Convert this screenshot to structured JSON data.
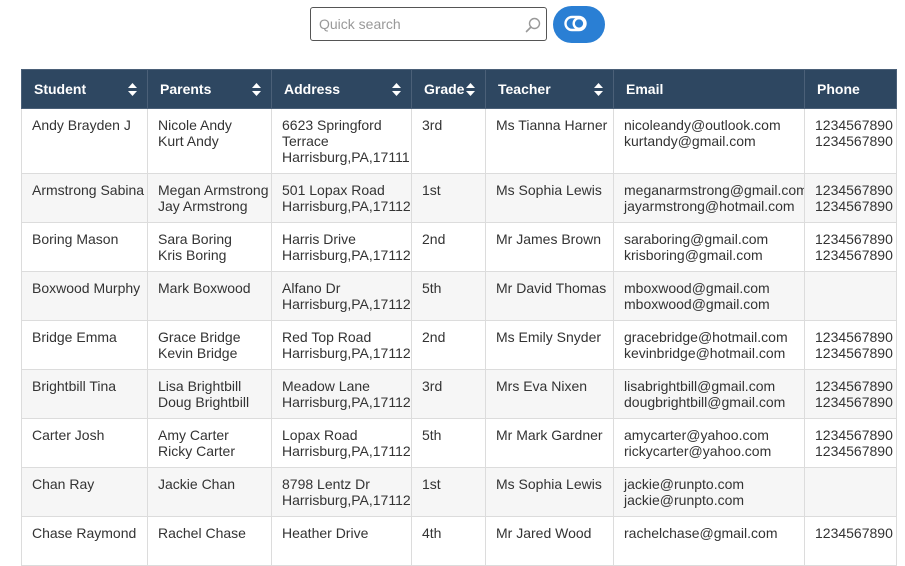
{
  "search": {
    "placeholder": "Quick search"
  },
  "table": {
    "headers": [
      "Student",
      "Parents",
      "Address",
      "Grade",
      "Teacher",
      "Email",
      "Phone"
    ],
    "rows": [
      {
        "student": "Andy Brayden J",
        "parents": [
          "Nicole Andy",
          "Kurt Andy"
        ],
        "address": [
          "6623 Springford",
          "Terrace",
          "Harrisburg,PA,17111"
        ],
        "grade": "3rd",
        "teacher": "Ms Tianna Harner",
        "email": [
          "nicoleandy@outlook.com",
          "kurtandy@gmail.com"
        ],
        "phone": [
          "1234567890",
          "1234567890"
        ]
      },
      {
        "student": "Armstrong Sabina",
        "parents": [
          "Megan Armstrong",
          "Jay Armstrong"
        ],
        "address": [
          "501 Lopax Road",
          "Harrisburg,PA,17112"
        ],
        "grade": "1st",
        "teacher": "Ms Sophia Lewis",
        "email": [
          "meganarmstrong@gmail.com",
          "jayarmstrong@hotmail.com"
        ],
        "phone": [
          "1234567890",
          "1234567890"
        ]
      },
      {
        "student": "Boring Mason",
        "parents": [
          "Sara Boring",
          "Kris Boring"
        ],
        "address": [
          "Harris Drive",
          "Harrisburg,PA,17112"
        ],
        "grade": "2nd",
        "teacher": "Mr James Brown",
        "email": [
          "saraboring@gmail.com",
          "krisboring@gmail.com"
        ],
        "phone": [
          "1234567890",
          "1234567890"
        ]
      },
      {
        "student": "Boxwood Murphy",
        "parents": [
          "Mark Boxwood"
        ],
        "address": [
          "Alfano Dr",
          "Harrisburg,PA,17112"
        ],
        "grade": "5th",
        "teacher": "Mr David Thomas",
        "email": [
          "mboxwood@gmail.com",
          "mboxwood@gmail.com"
        ],
        "phone": []
      },
      {
        "student": "Bridge Emma",
        "parents": [
          "Grace Bridge",
          "Kevin Bridge"
        ],
        "address": [
          "Red Top Road",
          "Harrisburg,PA,17112"
        ],
        "grade": "2nd",
        "teacher": "Ms Emily Snyder",
        "email": [
          "gracebridge@hotmail.com",
          "kevinbridge@hotmail.com"
        ],
        "phone": [
          "1234567890",
          "1234567890"
        ]
      },
      {
        "student": "Brightbill Tina",
        "parents": [
          "Lisa Brightbill",
          "Doug Brightbill"
        ],
        "address": [
          "Meadow Lane",
          "Harrisburg,PA,17112"
        ],
        "grade": "3rd",
        "teacher": "Mrs Eva Nixen",
        "email": [
          "lisabrightbill@gmail.com",
          "dougbrightbill@gmail.com"
        ],
        "phone": [
          "1234567890",
          "1234567890"
        ]
      },
      {
        "student": "Carter Josh",
        "parents": [
          "Amy Carter",
          "Ricky Carter"
        ],
        "address": [
          "Lopax Road",
          "Harrisburg,PA,17112"
        ],
        "grade": "5th",
        "teacher": "Mr Mark Gardner",
        "email": [
          "amycarter@yahoo.com",
          "rickycarter@yahoo.com"
        ],
        "phone": [
          "1234567890",
          "1234567890"
        ]
      },
      {
        "student": "Chan Ray",
        "parents": [
          "Jackie Chan"
        ],
        "address": [
          "8798 Lentz Dr",
          "Harrisburg,PA,17112"
        ],
        "grade": "1st",
        "teacher": "Ms Sophia Lewis",
        "email": [
          "jackie@runpto.com",
          "jackie@runpto.com"
        ],
        "phone": []
      },
      {
        "student": "Chase Raymond",
        "parents": [
          "Rachel Chase"
        ],
        "address": [
          "Heather Drive"
        ],
        "grade": "4th",
        "teacher": "Mr Jared Wood",
        "email": [
          "rachelchase@gmail.com"
        ],
        "phone": [
          "1234567890"
        ]
      }
    ]
  }
}
